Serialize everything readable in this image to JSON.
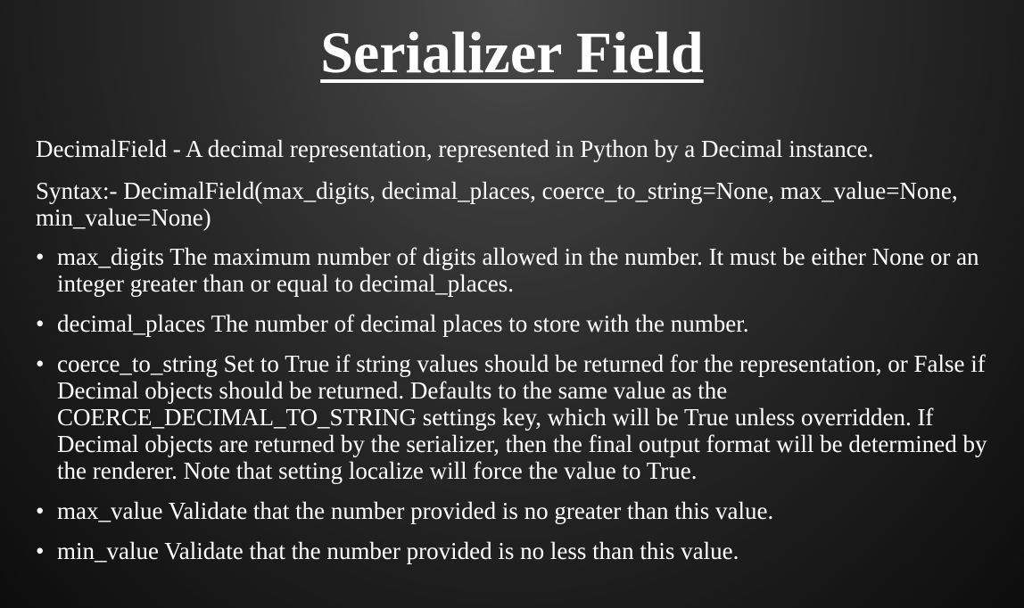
{
  "slide": {
    "title": "Serializer Field",
    "intro": "DecimalField - A decimal representation, represented in Python by a Decimal instance.",
    "syntax": "Syntax:- DecimalField(max_digits, decimal_places, coerce_to_string=None, max_value=None, min_value=None)",
    "bullet_glyph": "•",
    "bullets": [
      "max_digits The maximum number of digits allowed in the number. It must be either None or an integer greater than or equal to decimal_places.",
      "decimal_places The number of decimal places to store with the number.",
      "coerce_to_string Set to True if string values should be returned for the representation, or False if Decimal objects should be returned. Defaults to the same value as the COERCE_DECIMAL_TO_STRING settings key, which will be True unless overridden. If Decimal objects are returned by the serializer, then the final output format will be determined by the renderer. Note that setting localize will force the value to True.",
      "max_value Validate that the number provided is no greater than this value.",
      "min_value Validate that the number provided is no less than this value."
    ]
  }
}
